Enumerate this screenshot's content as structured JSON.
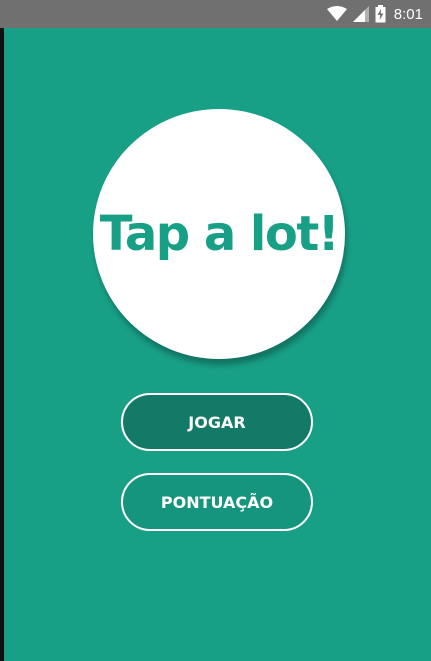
{
  "status_bar": {
    "time": "8:01",
    "icons": [
      "wifi-icon",
      "cell-signal-icon",
      "battery-charging-icon"
    ]
  },
  "app": {
    "logo_text": "Tap a lot!",
    "colors": {
      "background": "#18a087",
      "button_fill": "#127a66",
      "button_border": "#ffffff",
      "logo_circle": "#ffffff",
      "status_bar": "#707070"
    }
  },
  "buttons": {
    "play_label": "JOGAR",
    "score_label": "PONTUAÇÃO"
  }
}
